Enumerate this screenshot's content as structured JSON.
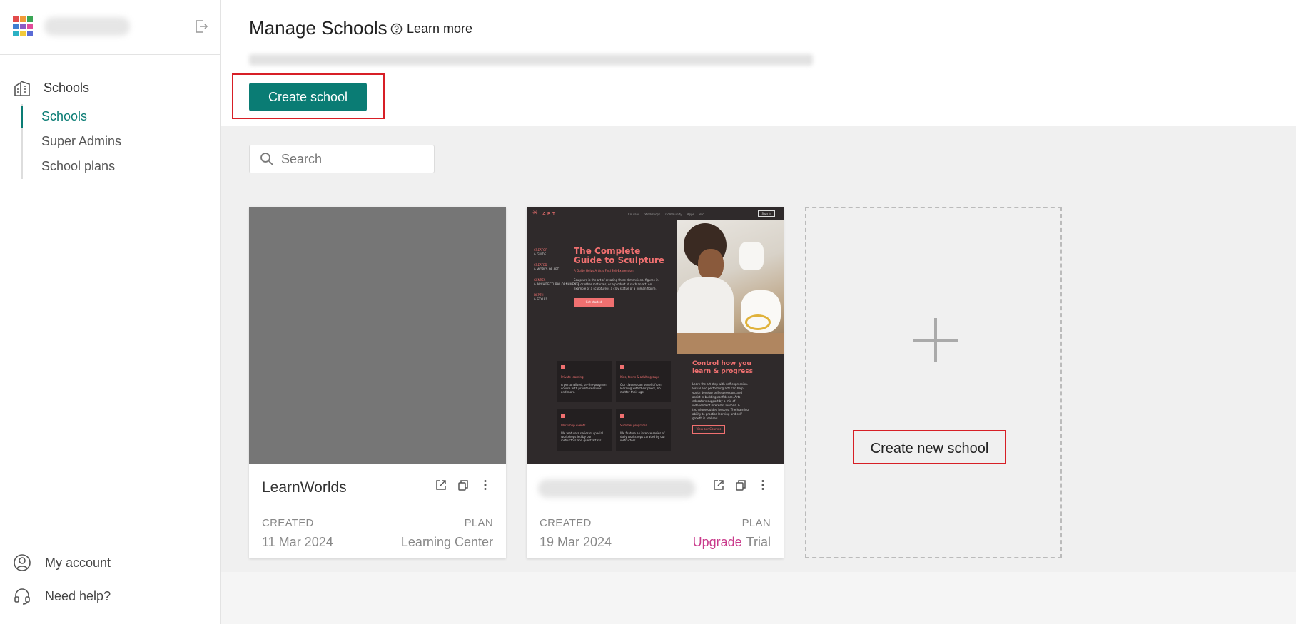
{
  "brand": {
    "logo_colors": [
      "#e24b4b",
      "#f29a38",
      "#3aa655",
      "#3f7fd1",
      "#8c5bc4",
      "#e24b9a",
      "#2bb1c4",
      "#f2c93b",
      "#5a6bd6"
    ]
  },
  "sidebar": {
    "section_label": "Schools",
    "items": [
      {
        "label": "Schools",
        "active": true
      },
      {
        "label": "Super Admins",
        "active": false
      },
      {
        "label": "School plans",
        "active": false
      }
    ],
    "bottom": [
      {
        "label": "My account",
        "icon": "user-circle-icon"
      },
      {
        "label": "Need help?",
        "icon": "headset-icon"
      }
    ]
  },
  "header": {
    "title": "Manage Schools",
    "learn_more": "Learn more",
    "create_button": "Create school"
  },
  "search": {
    "placeholder": "Search"
  },
  "schools": [
    {
      "name": "LearnWorlds",
      "created_label": "CREATED",
      "plan_label": "PLAN",
      "created": "11 Mar 2024",
      "plan": "Learning Center",
      "thumbnail_color": "#767676"
    },
    {
      "name": "",
      "created_label": "CREATED",
      "plan_label": "PLAN",
      "created": "19 Mar 2024",
      "upgrade": "Upgrade",
      "plan": "Trial",
      "thumbnail": {
        "brand": "A.R.T",
        "nav_links": "Courses  Workshops  Community  Apps  etc.",
        "signin": "Sign in",
        "sidebar": [
          {
            "k": "CREATOR",
            "v": "& GUIDE"
          },
          {
            "k": "CREATED",
            "v": "& WORKS OF ART"
          },
          {
            "k": "GENRES",
            "v": "& ARCHITECTURAL ORNAMENTS"
          },
          {
            "k": "DEPTH",
            "v": "& STYLES"
          }
        ],
        "heading": "The Complete Guide to Sculpture",
        "subheading": "A Guide Helps Artists Find Self-Expression",
        "paragraph": "Sculpture is the art of creating three-dimensional figures in clay or other materials, or a product of such an art. An example of a sculpture is a clay statue of a human figure.",
        "button": "Get started",
        "tiles": [
          {
            "title": "Private learning",
            "text": "A personalized, on-the-program course with private sessions and more."
          },
          {
            "title": "Kids, teens & adults groups",
            "text": "Our classes can benefit from learning with their peers, no matter their age."
          },
          {
            "title": "Workshop events",
            "text": "We feature a series of special workshops led by our instructors and guest artists."
          },
          {
            "title": "Summer programs",
            "text": "We feature an intense series of daily workshops curated by our instructors."
          }
        ],
        "heading2": "Control how you learn & progress",
        "paragraph2": "Learn the art step with self-expression. Visual and performing arts can help youth develop self-expression, and assist in building confidence. Arts educators support by a mix of independent interests, lessons, & technique-guided lessons. The learning ability to practise learning and self-growth is realised.",
        "button2": "View our Courses"
      }
    }
  ],
  "new_school_label": "Create new school"
}
